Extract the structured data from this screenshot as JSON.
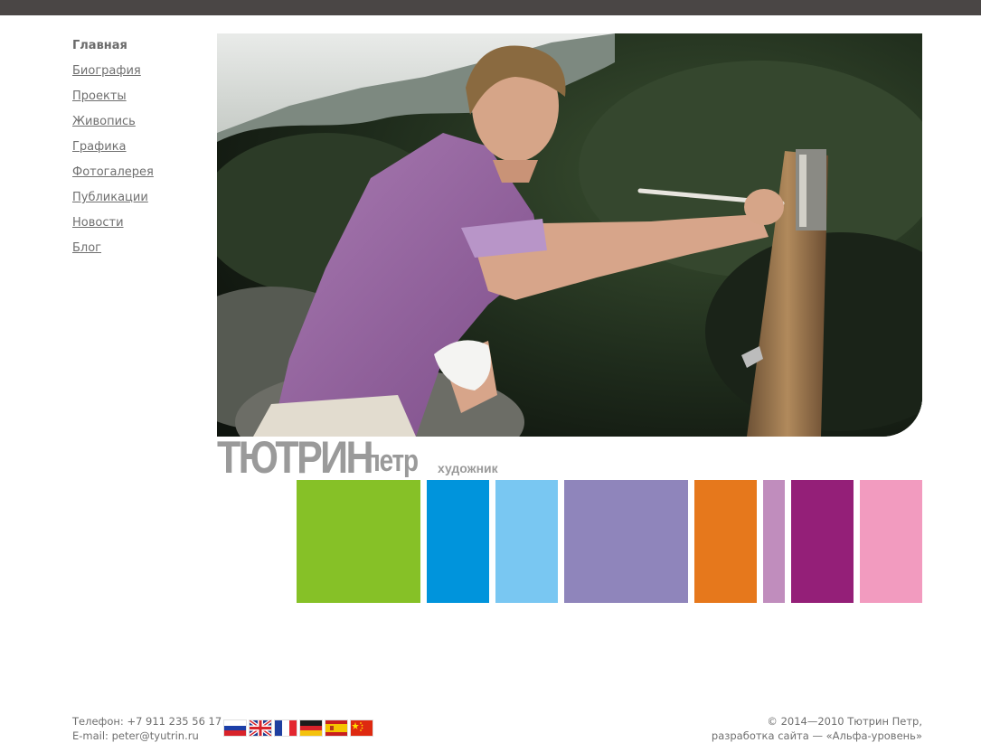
{
  "nav": {
    "items": [
      {
        "label": "Главная",
        "active": true
      },
      {
        "label": "Биография",
        "active": false
      },
      {
        "label": "Проекты",
        "active": false
      },
      {
        "label": "Живопись",
        "active": false
      },
      {
        "label": "Графика",
        "active": false
      },
      {
        "label": "Фотогалерея",
        "active": false
      },
      {
        "label": "Публикации",
        "active": false
      },
      {
        "label": "Новости",
        "active": false
      },
      {
        "label": "Блог",
        "active": false
      }
    ]
  },
  "hero": {
    "image_icon": "artist-painting-at-easel-photo"
  },
  "brand": {
    "surname": "ТЮТРИН",
    "name": "петр",
    "role": "художник"
  },
  "tiles": [
    {
      "color": "#86c127"
    },
    {
      "color": "#0094dc"
    },
    {
      "color": "#79c7f2"
    },
    {
      "color": "#8f85bb"
    },
    {
      "color": "#e6781c"
    },
    {
      "color": "#c08dbd"
    },
    {
      "color": "#941f78"
    },
    {
      "color": "#f29bbf"
    }
  ],
  "footer": {
    "phone": "Телефон: +7 911 235 56 17",
    "email": "E-mail: peter@tyutrin.ru",
    "copyright": "© 2014—2010 Тютрин Петр,",
    "developer": "разработка сайта — «Альфа-уровень»",
    "flags": [
      "russia-flag-icon",
      "uk-flag-icon",
      "france-flag-icon",
      "germany-flag-icon",
      "spain-flag-icon",
      "china-flag-icon"
    ]
  },
  "colors": {
    "topbar": "#4a4645",
    "text": "#6f6f6f",
    "brand_gray": "#9a9a9a"
  }
}
